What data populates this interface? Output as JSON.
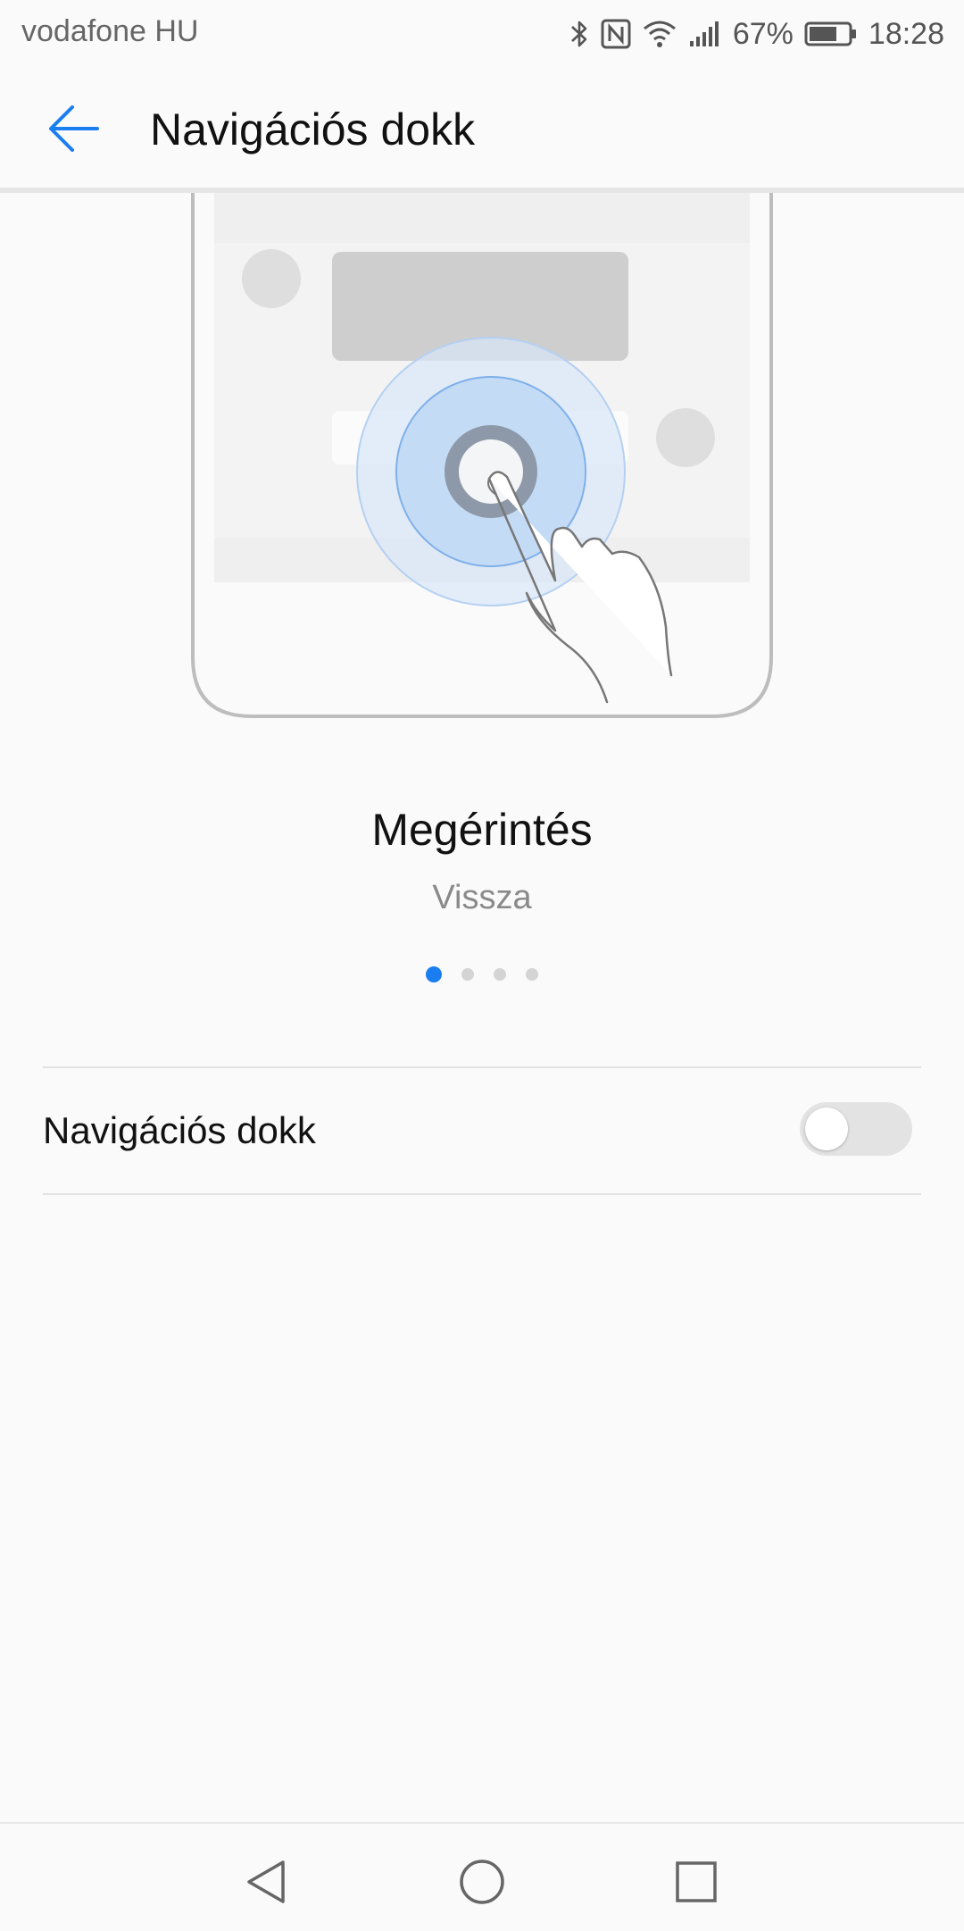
{
  "status_bar": {
    "carrier": "vodafone HU",
    "battery_percent": "67%",
    "time": "18:28",
    "icons": [
      "bluetooth-icon",
      "nfc-icon",
      "wifi-icon",
      "signal-icon",
      "battery-icon"
    ]
  },
  "app_bar": {
    "back_icon": "arrow-left-icon",
    "title": "Navigációs dokk"
  },
  "illustration": {
    "description_icon": "tap-gesture-illustration"
  },
  "gesture": {
    "title": "Megérintés",
    "subtitle": "Vissza"
  },
  "pager": {
    "count": 4,
    "active_index": 0
  },
  "setting": {
    "label": "Navigációs dokk",
    "enabled": false
  },
  "nav_bar": {
    "icons": [
      "back-triangle-icon",
      "home-circle-icon",
      "recents-square-icon"
    ]
  },
  "colors": {
    "accent": "#1b7ef0",
    "background": "#fafafa",
    "toggle_off": "#e3e3e3",
    "secondary_text": "#8a8a8a"
  }
}
